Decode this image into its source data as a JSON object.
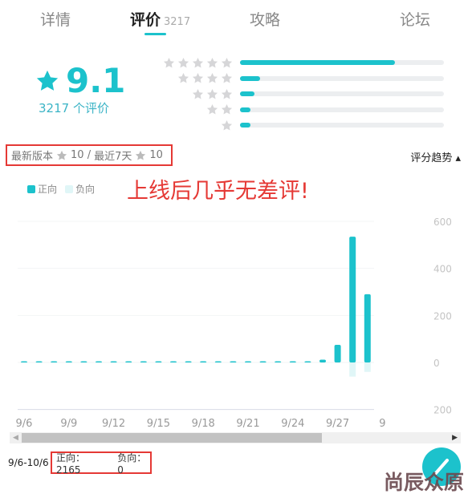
{
  "tabs": [
    {
      "label": "详情"
    },
    {
      "label": "评价",
      "count": "3217",
      "active": true
    },
    {
      "label": "攻略"
    },
    {
      "label": "论坛"
    }
  ],
  "rating": {
    "score": "9.1",
    "count_label": "3217 个评价",
    "distribution": [
      {
        "stars": 5,
        "fraction": 0.76
      },
      {
        "stars": 4,
        "fraction": 0.1
      },
      {
        "stars": 3,
        "fraction": 0.07
      },
      {
        "stars": 2,
        "fraction": 0.04
      },
      {
        "stars": 1,
        "fraction": 0.05
      }
    ]
  },
  "version": {
    "latest_label": "最新版本",
    "latest_score": "10 /",
    "recent_label": "最近7天",
    "recent_score": "10"
  },
  "trend_label": "评分趋势 ▴",
  "legend": {
    "positive": "正向",
    "negative": "负向"
  },
  "annotation": "上线后几乎无差评!",
  "colors": {
    "accent": "#1cc2cc",
    "negative": "#e0f6f7",
    "annotation": "#e53935"
  },
  "chart_data": {
    "type": "bar",
    "categories": [
      "9/6",
      "9/7",
      "9/8",
      "9/9",
      "9/10",
      "9/11",
      "9/12",
      "9/13",
      "9/14",
      "9/15",
      "9/16",
      "9/17",
      "9/18",
      "9/19",
      "9/20",
      "9/21",
      "9/22",
      "9/23",
      "9/24",
      "9/25",
      "9/26",
      "9/27",
      "9/28",
      "9/29"
    ],
    "series": [
      {
        "name": "正向",
        "values": [
          2,
          0,
          0,
          5,
          3,
          3,
          3,
          0,
          0,
          0,
          0,
          0,
          0,
          3,
          5,
          3,
          3,
          3,
          5,
          3,
          12,
          75,
          535,
          290
        ]
      },
      {
        "name": "负向",
        "values": [
          0,
          0,
          0,
          0,
          0,
          0,
          0,
          0,
          0,
          0,
          0,
          0,
          0,
          0,
          0,
          0,
          0,
          0,
          0,
          0,
          0,
          0,
          -60,
          -40
        ]
      }
    ],
    "x_tick_labels": [
      "9/6",
      "9/9",
      "9/12",
      "9/15",
      "9/18",
      "9/21",
      "9/24",
      "9/27",
      "9"
    ],
    "y_tick_labels": [
      "600",
      "400",
      "200",
      "0",
      "200"
    ],
    "ylim": [
      -200,
      600
    ],
    "grid": true,
    "legend": "top-left"
  },
  "footer": {
    "range": "9/6-10/6",
    "positive": "正向：2165",
    "negative": "负向：0"
  },
  "watermark": "尚辰众原"
}
